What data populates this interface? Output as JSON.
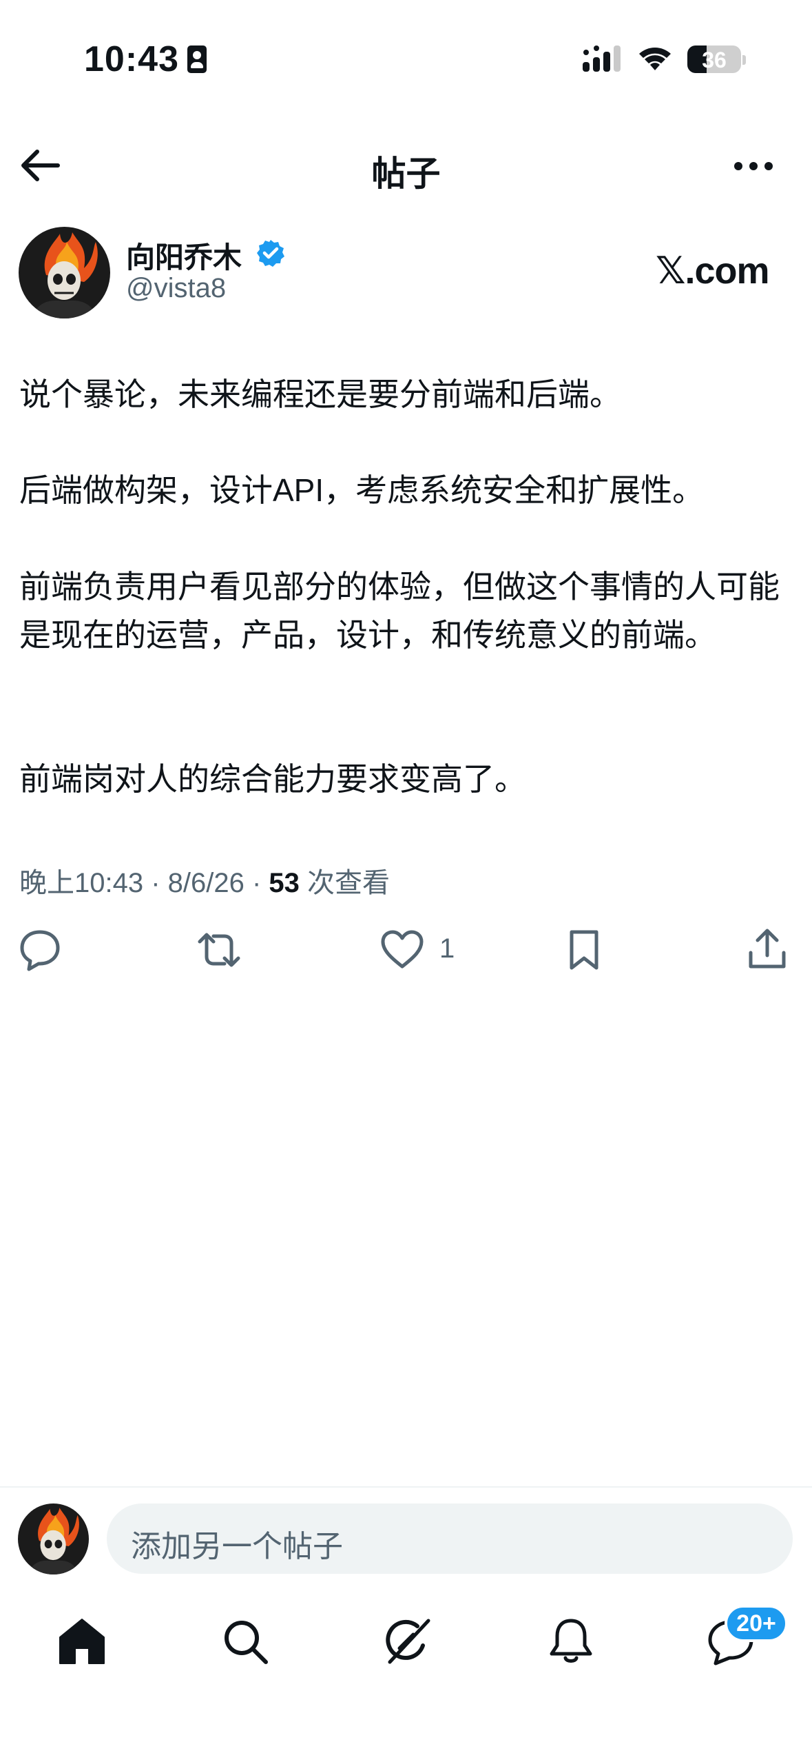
{
  "status_bar": {
    "time": "10:43",
    "battery": "36"
  },
  "header": {
    "title": "帖子"
  },
  "post": {
    "author_name": "向阳乔木",
    "author_handle": "@vista8",
    "brand": "𝕏.com",
    "paragraphs": [
      "说个暴论，未来编程还是要分前端和后端。",
      "后端做构架，设计API，考虑系统安全和扩展性。",
      "前端负责用户看见部分的体验，但做这个事情的人可能是现在的运营，产品，设计，和传统意义的前端。",
      "前端岗对人的综合能力要求变高了。"
    ],
    "time": "晚上10:43",
    "date": "8/6/26",
    "views_count": "53",
    "views_label": "次查看"
  },
  "actions": {
    "like_count": "1"
  },
  "reply_bar": {
    "placeholder": "添加另一个帖子"
  },
  "tab_bar": {
    "messages_badge": "20+"
  },
  "icons": [
    "back-arrow-icon",
    "more-icon",
    "verified-badge-icon",
    "reply-icon",
    "repost-icon",
    "heart-icon",
    "bookmark-icon",
    "share-icon",
    "home-icon",
    "search-icon",
    "grok-icon",
    "notifications-icon",
    "messages-icon"
  ],
  "colors": {
    "accent": "#1d9bf0",
    "text": "#0f1419",
    "secondary": "#536471",
    "input_bg": "#eff3f4"
  }
}
